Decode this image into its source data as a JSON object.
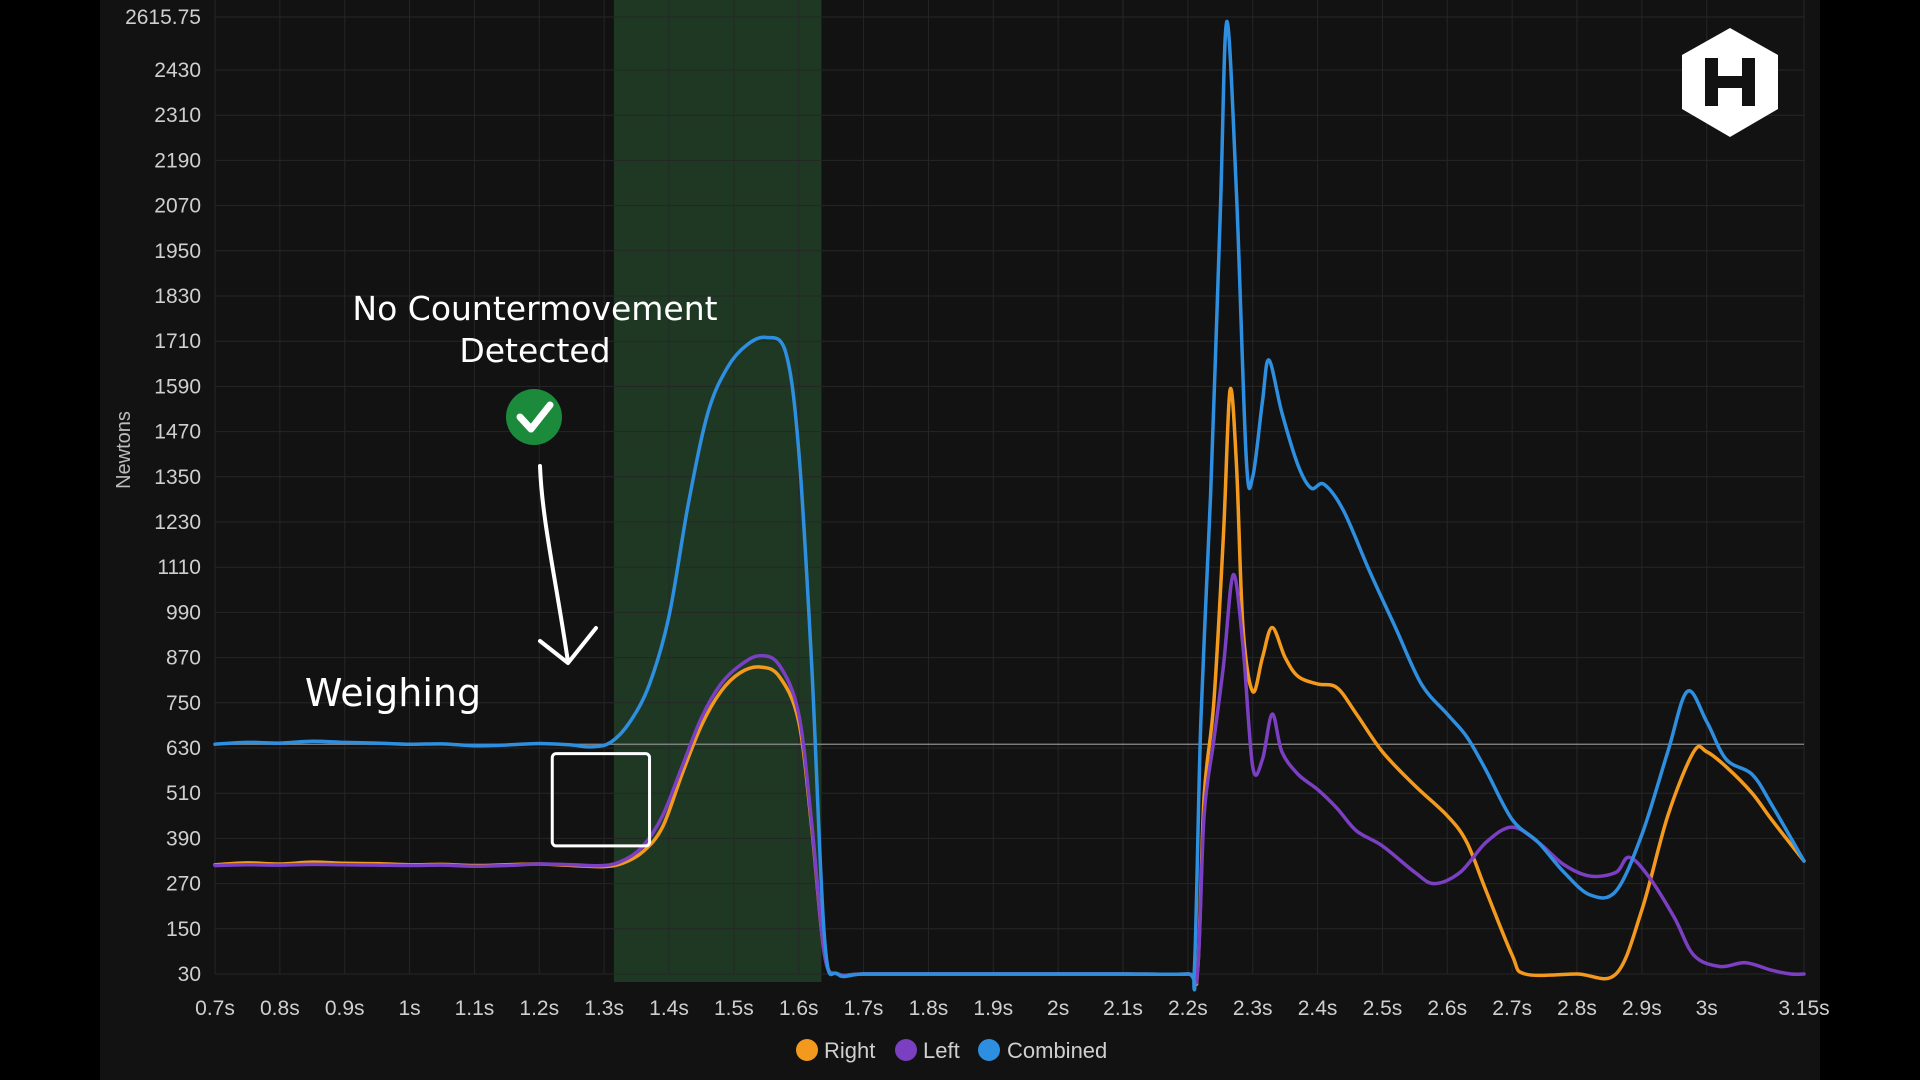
{
  "colors": {
    "background": "#121212",
    "grid": "#262626",
    "highlight": "#1f3823",
    "right": "#f39a1e",
    "left": "#7b3fc2",
    "combined": "#2e8fe0",
    "check": "#1b8a3a"
  },
  "icons": {
    "logo": "hexagon-h-logo",
    "check": "check-circle-icon",
    "arrow": "hand-drawn-arrow-icon"
  },
  "annotations": {
    "no_cm_line1": "No Countermovement",
    "no_cm_line2": "Detected",
    "weighing": "Weighing"
  },
  "chart_data": {
    "type": "line",
    "ylabel": "Newtons",
    "ylim": [
      30,
      2615.75
    ],
    "yticks": [
      "30",
      "150",
      "270",
      "390",
      "510",
      "630",
      "750",
      "870",
      "990",
      "1110",
      "1230",
      "1350",
      "1470",
      "1590",
      "1710",
      "1830",
      "1950",
      "2070",
      "2190",
      "2310",
      "2430",
      "2615.75"
    ],
    "xlim": [
      0.7,
      3.15
    ],
    "xticks": [
      {
        "v": 0.7,
        "label": "0.7s"
      },
      {
        "v": 0.8,
        "label": "0.8s"
      },
      {
        "v": 0.9,
        "label": "0.9s"
      },
      {
        "v": 1.0,
        "label": "1s"
      },
      {
        "v": 1.1,
        "label": "1.1s"
      },
      {
        "v": 1.2,
        "label": "1.2s"
      },
      {
        "v": 1.3,
        "label": "1.3s"
      },
      {
        "v": 1.4,
        "label": "1.4s"
      },
      {
        "v": 1.5,
        "label": "1.5s"
      },
      {
        "v": 1.6,
        "label": "1.6s"
      },
      {
        "v": 1.7,
        "label": "1.7s"
      },
      {
        "v": 1.8,
        "label": "1.8s"
      },
      {
        "v": 1.9,
        "label": "1.9s"
      },
      {
        "v": 2.0,
        "label": "2s"
      },
      {
        "v": 2.1,
        "label": "2.1s"
      },
      {
        "v": 2.2,
        "label": "2.2s"
      },
      {
        "v": 2.3,
        "label": "2.3s"
      },
      {
        "v": 2.4,
        "label": "2.4s"
      },
      {
        "v": 2.5,
        "label": "2.5s"
      },
      {
        "v": 2.6,
        "label": "2.6s"
      },
      {
        "v": 2.7,
        "label": "2.7s"
      },
      {
        "v": 2.8,
        "label": "2.8s"
      },
      {
        "v": 2.9,
        "label": "2.9s"
      },
      {
        "v": 3.0,
        "label": "3s"
      },
      {
        "v": 3.15,
        "label": "3.15s"
      }
    ],
    "grid": true,
    "reference_line": 640,
    "highlight_range": [
      1.315,
      1.635
    ],
    "weighing_box": {
      "x": [
        1.22,
        1.37
      ],
      "y": [
        370,
        615
      ]
    },
    "legend_position": "bottom-center",
    "series": [
      {
        "name": "Right",
        "color_key": "right",
        "points": [
          [
            0.7,
            320
          ],
          [
            0.75,
            325
          ],
          [
            0.8,
            322
          ],
          [
            0.85,
            327
          ],
          [
            0.9,
            324
          ],
          [
            0.95,
            323
          ],
          [
            1.0,
            320
          ],
          [
            1.05,
            321
          ],
          [
            1.1,
            318
          ],
          [
            1.15,
            320
          ],
          [
            1.2,
            322
          ],
          [
            1.25,
            318
          ],
          [
            1.3,
            315
          ],
          [
            1.33,
            325
          ],
          [
            1.36,
            355
          ],
          [
            1.39,
            420
          ],
          [
            1.42,
            560
          ],
          [
            1.45,
            690
          ],
          [
            1.48,
            780
          ],
          [
            1.51,
            830
          ],
          [
            1.54,
            845
          ],
          [
            1.57,
            820
          ],
          [
            1.6,
            700
          ],
          [
            1.62,
            420
          ],
          [
            1.64,
            80
          ],
          [
            1.66,
            30
          ],
          [
            1.7,
            30
          ],
          [
            1.8,
            30
          ],
          [
            1.9,
            30
          ],
          [
            2.0,
            30
          ],
          [
            2.1,
            30
          ],
          [
            2.2,
            30
          ],
          [
            2.215,
            40
          ],
          [
            2.225,
            500
          ],
          [
            2.24,
            750
          ],
          [
            2.255,
            1200
          ],
          [
            2.265,
            1580
          ],
          [
            2.275,
            1380
          ],
          [
            2.285,
            950
          ],
          [
            2.3,
            780
          ],
          [
            2.315,
            870
          ],
          [
            2.33,
            950
          ],
          [
            2.35,
            870
          ],
          [
            2.37,
            820
          ],
          [
            2.4,
            800
          ],
          [
            2.43,
            790
          ],
          [
            2.46,
            720
          ],
          [
            2.5,
            620
          ],
          [
            2.55,
            530
          ],
          [
            2.6,
            450
          ],
          [
            2.63,
            380
          ],
          [
            2.66,
            250
          ],
          [
            2.7,
            80
          ],
          [
            2.72,
            30
          ],
          [
            2.8,
            30
          ],
          [
            2.86,
            30
          ],
          [
            2.9,
            200
          ],
          [
            2.94,
            450
          ],
          [
            2.98,
            620
          ],
          [
            3.0,
            620
          ],
          [
            3.03,
            580
          ],
          [
            3.07,
            510
          ],
          [
            3.1,
            440
          ],
          [
            3.15,
            330
          ]
        ]
      },
      {
        "name": "Left",
        "color_key": "left",
        "points": [
          [
            0.7,
            318
          ],
          [
            0.75,
            320
          ],
          [
            0.8,
            319
          ],
          [
            0.85,
            321
          ],
          [
            0.9,
            320
          ],
          [
            0.95,
            319
          ],
          [
            1.0,
            318
          ],
          [
            1.05,
            319
          ],
          [
            1.1,
            316
          ],
          [
            1.15,
            318
          ],
          [
            1.2,
            322
          ],
          [
            1.25,
            320
          ],
          [
            1.3,
            318
          ],
          [
            1.33,
            332
          ],
          [
            1.36,
            370
          ],
          [
            1.39,
            450
          ],
          [
            1.42,
            580
          ],
          [
            1.45,
            710
          ],
          [
            1.48,
            800
          ],
          [
            1.51,
            850
          ],
          [
            1.54,
            875
          ],
          [
            1.57,
            850
          ],
          [
            1.6,
            720
          ],
          [
            1.62,
            430
          ],
          [
            1.64,
            80
          ],
          [
            1.66,
            30
          ],
          [
            1.7,
            30
          ],
          [
            1.8,
            30
          ],
          [
            1.9,
            30
          ],
          [
            2.0,
            30
          ],
          [
            2.1,
            30
          ],
          [
            2.2,
            30
          ],
          [
            2.215,
            40
          ],
          [
            2.225,
            450
          ],
          [
            2.24,
            650
          ],
          [
            2.255,
            850
          ],
          [
            2.27,
            1090
          ],
          [
            2.285,
            900
          ],
          [
            2.3,
            580
          ],
          [
            2.315,
            600
          ],
          [
            2.33,
            720
          ],
          [
            2.345,
            620
          ],
          [
            2.37,
            560
          ],
          [
            2.4,
            520
          ],
          [
            2.43,
            470
          ],
          [
            2.46,
            410
          ],
          [
            2.5,
            370
          ],
          [
            2.55,
            300
          ],
          [
            2.58,
            270
          ],
          [
            2.62,
            300
          ],
          [
            2.66,
            380
          ],
          [
            2.7,
            420
          ],
          [
            2.74,
            380
          ],
          [
            2.78,
            320
          ],
          [
            2.82,
            290
          ],
          [
            2.86,
            300
          ],
          [
            2.88,
            340
          ],
          [
            2.91,
            290
          ],
          [
            2.95,
            180
          ],
          [
            2.98,
            80
          ],
          [
            3.02,
            50
          ],
          [
            3.06,
            60
          ],
          [
            3.1,
            40
          ],
          [
            3.13,
            30
          ],
          [
            3.15,
            30
          ]
        ]
      },
      {
        "name": "Combined",
        "color_key": "combined",
        "points": [
          [
            0.7,
            640
          ],
          [
            0.75,
            645
          ],
          [
            0.8,
            643
          ],
          [
            0.85,
            648
          ],
          [
            0.9,
            645
          ],
          [
            0.95,
            643
          ],
          [
            1.0,
            640
          ],
          [
            1.05,
            641
          ],
          [
            1.1,
            636
          ],
          [
            1.15,
            638
          ],
          [
            1.2,
            642
          ],
          [
            1.25,
            638
          ],
          [
            1.28,
            633
          ],
          [
            1.31,
            645
          ],
          [
            1.34,
            700
          ],
          [
            1.37,
            800
          ],
          [
            1.4,
            980
          ],
          [
            1.43,
            1280
          ],
          [
            1.46,
            1520
          ],
          [
            1.49,
            1640
          ],
          [
            1.52,
            1700
          ],
          [
            1.55,
            1720
          ],
          [
            1.58,
            1680
          ],
          [
            1.6,
            1420
          ],
          [
            1.62,
            850
          ],
          [
            1.64,
            120
          ],
          [
            1.66,
            30
          ],
          [
            1.7,
            30
          ],
          [
            1.8,
            30
          ],
          [
            1.9,
            30
          ],
          [
            2.0,
            30
          ],
          [
            2.1,
            30
          ],
          [
            2.2,
            30
          ],
          [
            2.21,
            40
          ],
          [
            2.22,
            700
          ],
          [
            2.235,
            1300
          ],
          [
            2.25,
            2050
          ],
          [
            2.26,
            2600
          ],
          [
            2.275,
            2100
          ],
          [
            2.29,
            1400
          ],
          [
            2.3,
            1350
          ],
          [
            2.315,
            1550
          ],
          [
            2.325,
            1660
          ],
          [
            2.345,
            1520
          ],
          [
            2.37,
            1380
          ],
          [
            2.39,
            1320
          ],
          [
            2.41,
            1330
          ],
          [
            2.44,
            1260
          ],
          [
            2.48,
            1100
          ],
          [
            2.52,
            950
          ],
          [
            2.56,
            800
          ],
          [
            2.6,
            720
          ],
          [
            2.63,
            660
          ],
          [
            2.66,
            570
          ],
          [
            2.7,
            440
          ],
          [
            2.74,
            380
          ],
          [
            2.78,
            300
          ],
          [
            2.82,
            240
          ],
          [
            2.86,
            250
          ],
          [
            2.9,
            400
          ],
          [
            2.94,
            620
          ],
          [
            2.97,
            780
          ],
          [
            3.0,
            700
          ],
          [
            3.03,
            600
          ],
          [
            3.07,
            560
          ],
          [
            3.1,
            480
          ],
          [
            3.15,
            330
          ]
        ]
      }
    ]
  }
}
